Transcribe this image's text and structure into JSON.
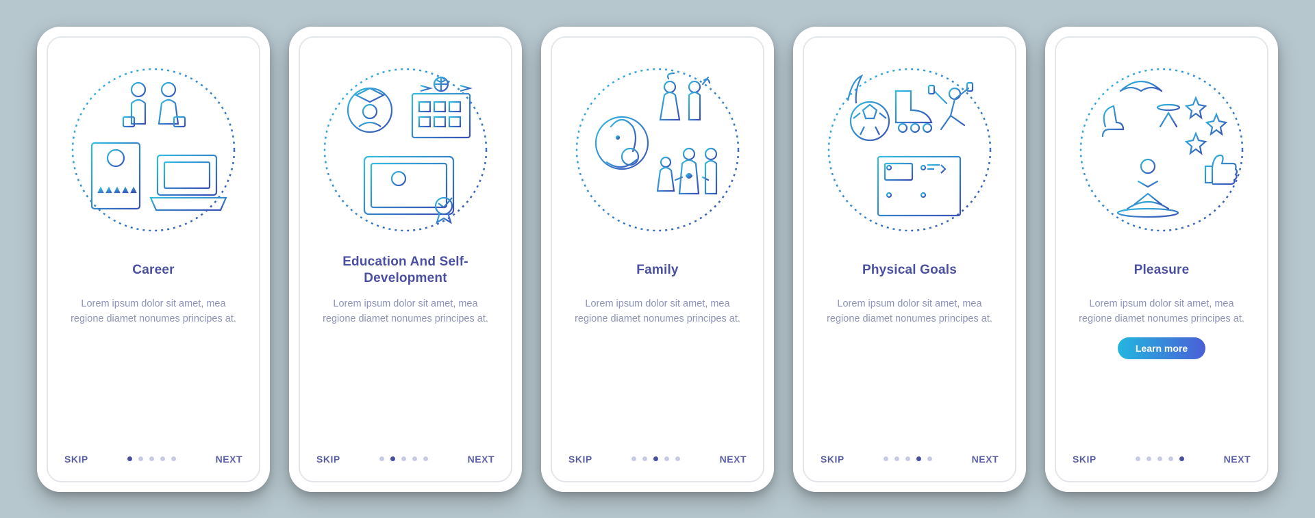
{
  "common": {
    "skip_label": "SKIP",
    "next_label": "NEXT",
    "learn_more_label": "Learn more",
    "dot_count": 5,
    "lorem": "Lorem ipsum dolor sit amet, mea regione diamet, nonumes principes at."
  },
  "screens": [
    {
      "title": "Career",
      "icon_name": "career-icon",
      "desc": "Lorem ipsum dolor sit amet, mea regione diamet nonumes principes at.",
      "active_dot": 0,
      "has_button": false
    },
    {
      "title": "Education And Self-Development",
      "icon_name": "education-icon",
      "desc": "Lorem ipsum dolor sit amet, mea regione diamet nonumes principes at.",
      "active_dot": 1,
      "has_button": false
    },
    {
      "title": "Family",
      "icon_name": "family-icon",
      "desc": "Lorem ipsum dolor sit amet, mea regione diamet nonumes principes at.",
      "active_dot": 2,
      "has_button": false
    },
    {
      "title": "Physical Goals",
      "icon_name": "physical-goals-icon",
      "desc": "Lorem ipsum dolor sit amet, mea regione diamet nonumes principes at.",
      "active_dot": 3,
      "has_button": false
    },
    {
      "title": "Pleasure",
      "icon_name": "pleasure-icon",
      "desc": "Lorem ipsum dolor sit amet, mea regione diamet nonumes principes at.",
      "active_dot": 4,
      "has_button": true
    }
  ],
  "colors": {
    "background": "#b7c7ce",
    "title": "#4a4fa0",
    "desc": "#8e93b9",
    "stroke_light": "#33bce0",
    "stroke_dark": "#3a4fb6",
    "gradient_start": "#23b6df",
    "gradient_end": "#4a5fd6"
  }
}
